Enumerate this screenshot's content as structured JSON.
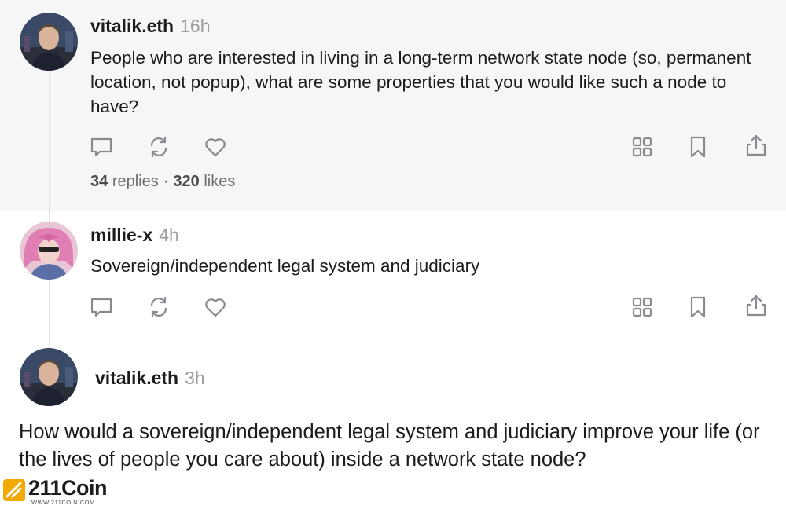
{
  "colors": {
    "panel": "#f6f6f7",
    "muted": "#9b9ba0",
    "icon": "#8a8a90",
    "watermark_accent": "#f2a900"
  },
  "posts": [
    {
      "handle": "vitalik.eth",
      "time": "16h",
      "text": "People who are interested in living in a long-term network state node (so, permanent location, not popup), what are some properties that you would like such a node to have?",
      "replies_count": "34",
      "replies_label": "replies",
      "separator": "·",
      "likes_count": "320",
      "likes_label": "likes"
    },
    {
      "handle": "millie-x",
      "time": "4h",
      "text": "Sovereign/independent legal system and judiciary"
    },
    {
      "handle": "vitalik.eth",
      "time": "3h",
      "text": "How would a sovereign/independent legal system and judiciary improve your life (or the lives of people you care about) inside a network state node?"
    }
  ],
  "icons": [
    "comment-icon",
    "repost-icon",
    "heart-icon",
    "grid-icon",
    "bookmark-icon",
    "share-icon"
  ],
  "watermark": {
    "brand": "211Coin",
    "url": "WWW.211COIN.COM"
  }
}
